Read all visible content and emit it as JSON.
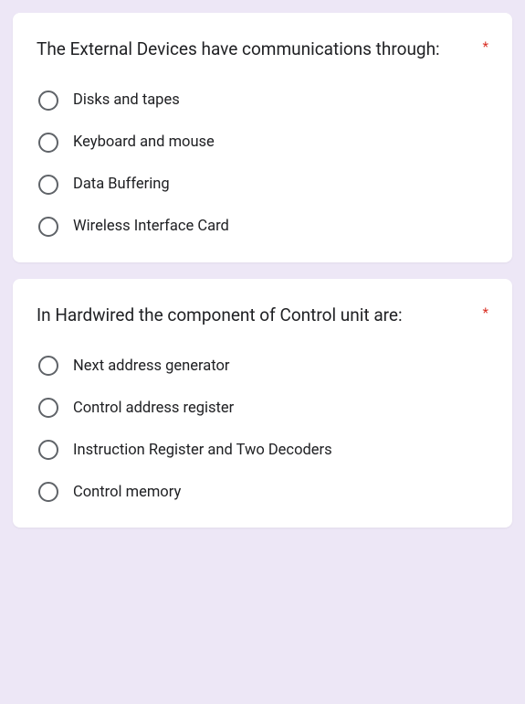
{
  "questions": [
    {
      "title": "The External Devices have communications through:",
      "required": "*",
      "options": [
        {
          "label": "Disks and tapes"
        },
        {
          "label": "Keyboard and mouse"
        },
        {
          "label": "Data Buffering"
        },
        {
          "label": "Wireless Interface Card"
        }
      ]
    },
    {
      "title": "In Hardwired the component of Control unit are:",
      "required": "*",
      "options": [
        {
          "label": "Next address generator"
        },
        {
          "label": "Control address register"
        },
        {
          "label": "Instruction Register and Two Decoders"
        },
        {
          "label": "Control memory"
        }
      ]
    }
  ]
}
